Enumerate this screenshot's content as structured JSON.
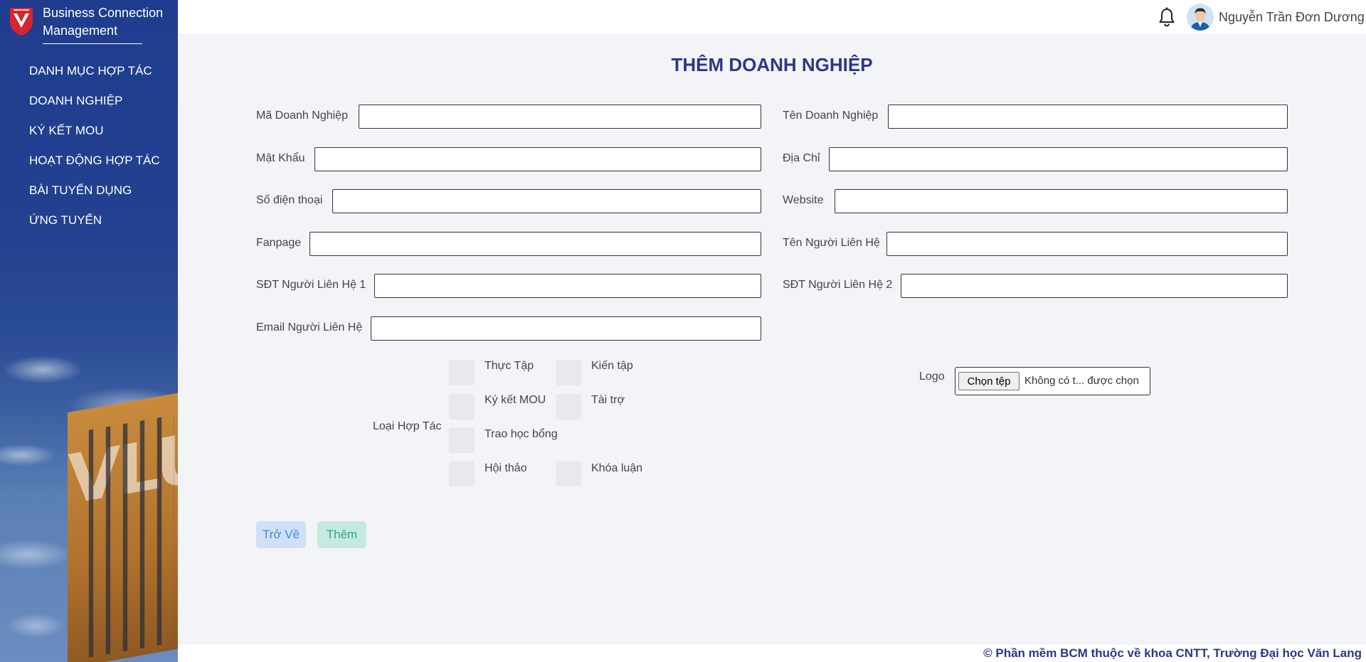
{
  "app": {
    "title": "Business Connection Management",
    "title_line1": "Business Connection",
    "title_line2": "Management",
    "accent_color": "#2e3787",
    "sidebar_color": "#1f3c8f"
  },
  "sidebar": {
    "items": [
      {
        "label": "DANH MỤC HỢP TÁC"
      },
      {
        "label": "DOANH NGHIỆP"
      },
      {
        "label": "KÝ KẾT MOU"
      },
      {
        "label": "HOẠT ĐỘNG HỢP TÁC"
      },
      {
        "label": "BÀI TUYỂN DỤNG"
      },
      {
        "label": "ỨNG TUYỂN"
      }
    ]
  },
  "header": {
    "username": "Nguyễn Trần Đơn Dương",
    "bell_icon": "bell-icon",
    "avatar_icon": "user-avatar"
  },
  "form": {
    "title": "THÊM DOANH NGHIỆP",
    "fields": {
      "ma_dn": {
        "label": "Mã Doanh Nghiệp",
        "value": ""
      },
      "ten_dn": {
        "label": "Tên Doanh Nghiệp",
        "value": ""
      },
      "mat_khau": {
        "label": "Mật Khẩu",
        "value": ""
      },
      "dia_chi": {
        "label": "Địa Chỉ",
        "value": ""
      },
      "sdt": {
        "label": "Số điện thoại",
        "value": ""
      },
      "website": {
        "label": "Website",
        "value": ""
      },
      "fanpage": {
        "label": "Fanpage",
        "value": ""
      },
      "ten_nguoi_lh": {
        "label": "Tên Người Liên Hệ",
        "value": ""
      },
      "sdt_lh1": {
        "label": "SĐT Người Liên Hệ 1",
        "value": ""
      },
      "sdt_lh2": {
        "label": "SĐT Người Liên Hệ 2",
        "value": ""
      },
      "email_lh": {
        "label": "Email Người Liên Hệ",
        "value": ""
      }
    },
    "loai_hop_tac": {
      "label": "Loại Hợp Tác",
      "options": [
        {
          "label": "Thực Tập",
          "checked": false
        },
        {
          "label": "Kiến tập",
          "checked": false
        },
        {
          "label": "Ký kết MOU",
          "checked": false
        },
        {
          "label": "Tài trợ",
          "checked": false
        },
        {
          "label": "Trao học bổng",
          "checked": false
        },
        {
          "label": "Hội thảo",
          "checked": false
        },
        {
          "label": "Khóa luận",
          "checked": false
        }
      ]
    },
    "logo": {
      "label": "Logo",
      "button_label": "Chọn tệp",
      "file_status": "Không có t... được chọn"
    },
    "buttons": {
      "back_label": "Trở Về",
      "add_label": "Thêm"
    }
  },
  "footer": {
    "text": "© Phần mềm BCM thuộc về khoa CNTT, Trường Đại học Văn Lang"
  }
}
